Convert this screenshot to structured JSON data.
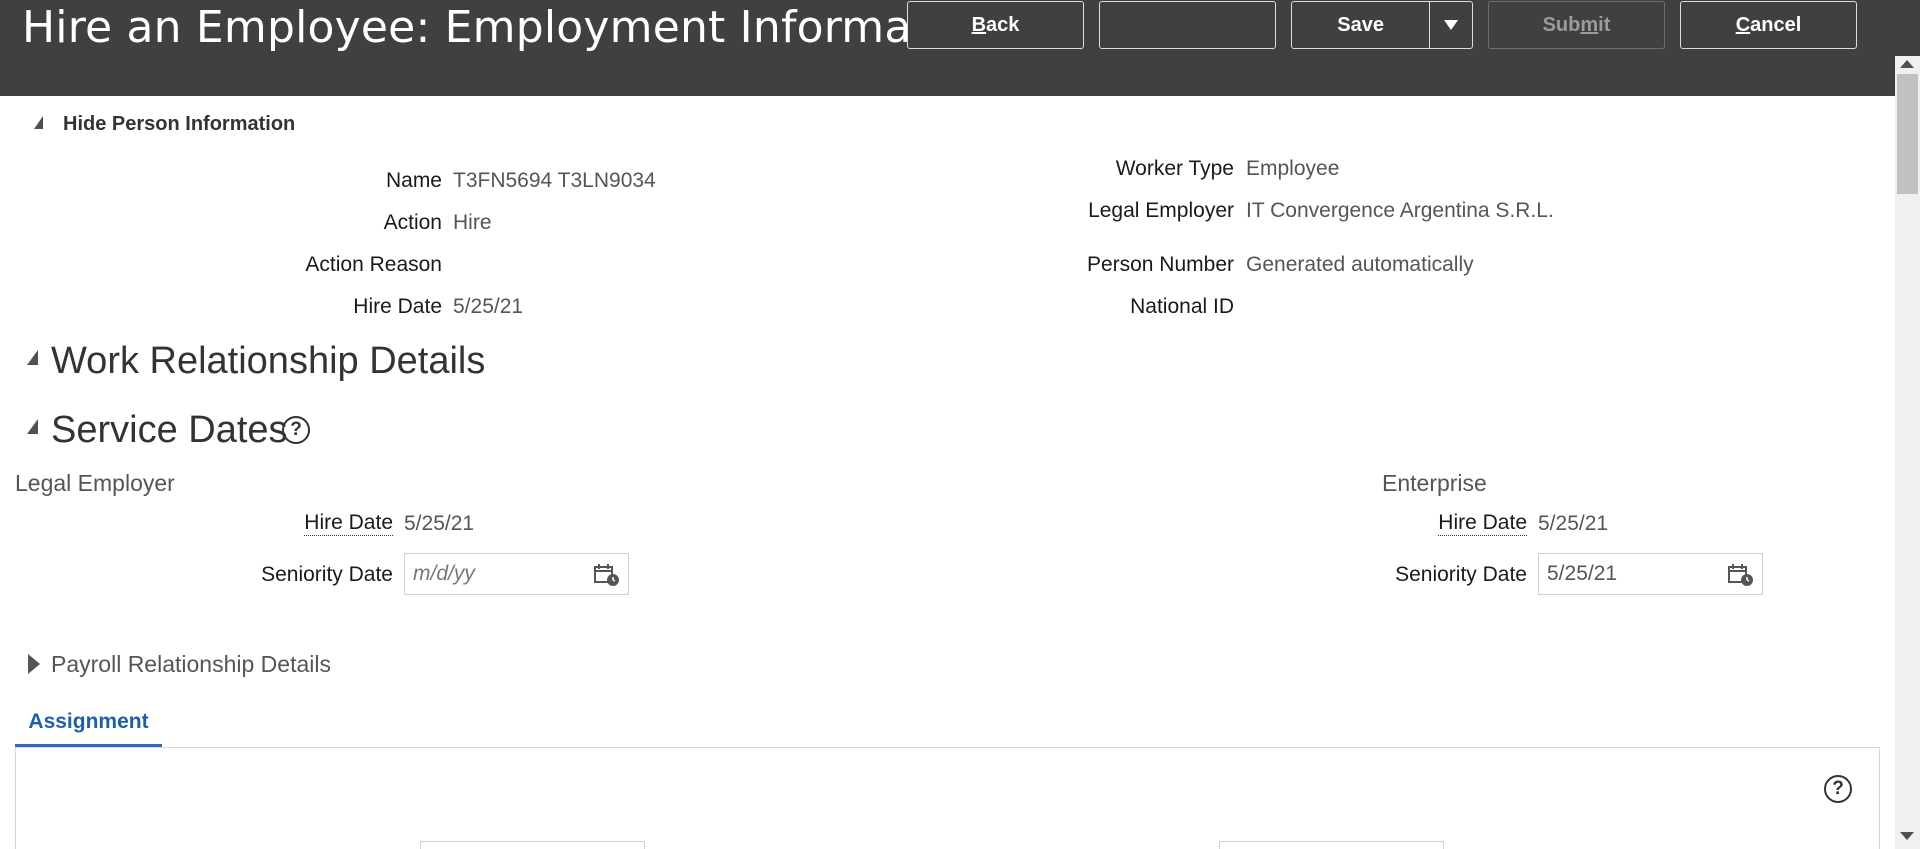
{
  "header": {
    "title": "Hire an Employee: Employment Information",
    "buttons": {
      "back": {
        "mnemonic": "B",
        "rest": "ack"
      },
      "blank": "",
      "save": "Save",
      "submit": {
        "pre": "Sub",
        "mnemonic": "m",
        "post": "it"
      },
      "cancel": {
        "mnemonic": "C",
        "rest": "ancel"
      }
    }
  },
  "person_info": {
    "toggle_label": "Hide Person Information",
    "left": [
      {
        "label": "Name",
        "value": "T3FN5694 T3LN9034"
      },
      {
        "label": "Action",
        "value": "Hire"
      },
      {
        "label": "Action Reason",
        "value": ""
      },
      {
        "label": "Hire Date",
        "value": "5/25/21"
      }
    ],
    "right": [
      {
        "label": "Worker Type",
        "value": "Employee"
      },
      {
        "label": "Legal Employer",
        "value": "IT Convergence Argentina S.R.L."
      },
      {
        "label": "Person Number",
        "value": "Generated automatically"
      },
      {
        "label": "National ID",
        "value": ""
      }
    ]
  },
  "sections": {
    "work_relationship": "Work Relationship Details",
    "service_dates": "Service Dates",
    "help_glyph": "?",
    "payroll": "Payroll Relationship Details"
  },
  "service_dates": {
    "legal_employer": {
      "heading": "Legal Employer",
      "hire_date_label": "Hire Date",
      "hire_date_value": "5/25/21",
      "seniority_label": "Seniority Date",
      "seniority_value": "",
      "seniority_placeholder": "m/d/yy"
    },
    "enterprise": {
      "heading": "Enterprise",
      "hire_date_label": "Hire Date",
      "hire_date_value": "5/25/21",
      "seniority_label": "Seniority Date",
      "seniority_value": "5/25/21",
      "seniority_placeholder": "m/d/yy"
    }
  },
  "tabs": {
    "assignment": "Assignment"
  },
  "icons": {
    "calendar": "calendar-icon",
    "help": "help-icon",
    "expand": "collapse-triangle-icon",
    "save_menu": "chevron-down-icon"
  },
  "colors": {
    "header_bg": "#404040",
    "tab_accent": "#2b6db8"
  }
}
